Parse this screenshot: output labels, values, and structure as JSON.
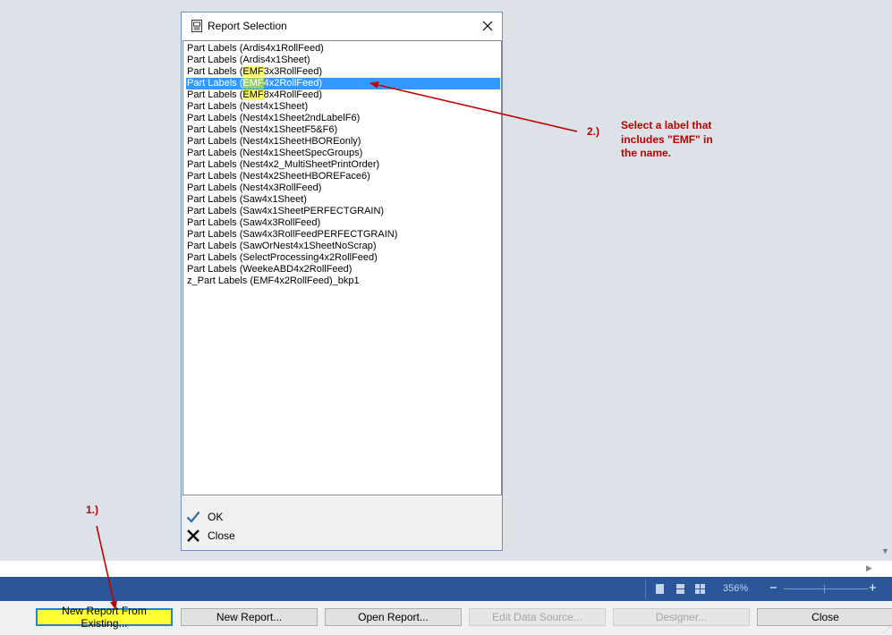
{
  "dialog": {
    "title": "Report Selection",
    "icon": "report-icon",
    "close_icon": "close-icon",
    "items": [
      {
        "label": "Part Labels (Ardis4x1RollFeed)"
      },
      {
        "label": "Part Labels (Ardis4x1Sheet)"
      },
      {
        "label_pre": "Part Labels (",
        "label_hl": "EMF",
        "label_post": "3x3RollFeed)"
      },
      {
        "label_pre": "Part Labels (",
        "label_hl": "EMF",
        "label_post": "4x2RollFeed)",
        "selected": true
      },
      {
        "label_pre": "Part Labels (",
        "label_hl": "EMF",
        "label_post": "8x4RollFeed)"
      },
      {
        "label": "Part Labels (Nest4x1Sheet)"
      },
      {
        "label": "Part Labels (Nest4x1Sheet2ndLabelF6)"
      },
      {
        "label": "Part Labels (Nest4x1SheetF5&F6)"
      },
      {
        "label": "Part Labels (Nest4x1SheetHBOREonly)"
      },
      {
        "label": "Part Labels (Nest4x1SheetSpecGroups)"
      },
      {
        "label": "Part Labels (Nest4x2_MultiSheetPrintOrder)"
      },
      {
        "label": "Part Labels (Nest4x2SheetHBOREFace6)"
      },
      {
        "label": "Part Labels (Nest4x3RollFeed)"
      },
      {
        "label": "Part Labels (Saw4x1Sheet)"
      },
      {
        "label": "Part Labels (Saw4x1SheetPERFECTGRAIN)"
      },
      {
        "label": "Part Labels (Saw4x3RollFeed)"
      },
      {
        "label": "Part Labels (Saw4x3RollFeedPERFECTGRAIN)"
      },
      {
        "label": "Part Labels (SawOrNest4x1SheetNoScrap)"
      },
      {
        "label": "Part Labels (SelectProcessing4x2RollFeed)"
      },
      {
        "label": "Part Labels (WeekeABD4x2RollFeed)"
      },
      {
        "label": "z_Part Labels (EMF4x2RollFeed)_bkp1"
      }
    ],
    "ok_label": "OK",
    "ok_icon": "checkmark-icon",
    "close_label": "Close",
    "close_btn_icon": "x-icon"
  },
  "statusbar": {
    "zoom": "356%",
    "view_icons": [
      "single-page-icon",
      "continuous-page-icon",
      "multi-page-icon"
    ],
    "zoom_out_icon": "minus-icon",
    "zoom_in_icon": "plus-icon"
  },
  "buttons": {
    "new_from_existing": "New Report From Existing...",
    "new_report": "New Report...",
    "open_report": "Open Report...",
    "edit_data_source": "Edit Data Source...",
    "designer": "Designer...",
    "close": "Close"
  },
  "annotations": {
    "step1": "1.)",
    "step2": "2.)",
    "note_line1": "Select a label that",
    "note_line2": "includes \"EMF\" in",
    "note_line3": "the name.",
    "color": "#c00000"
  },
  "colors": {
    "statusbar": "#2b579a",
    "selection": "#3399ff",
    "highlight": "#ffff66",
    "button_highlight": "#ffff33"
  }
}
